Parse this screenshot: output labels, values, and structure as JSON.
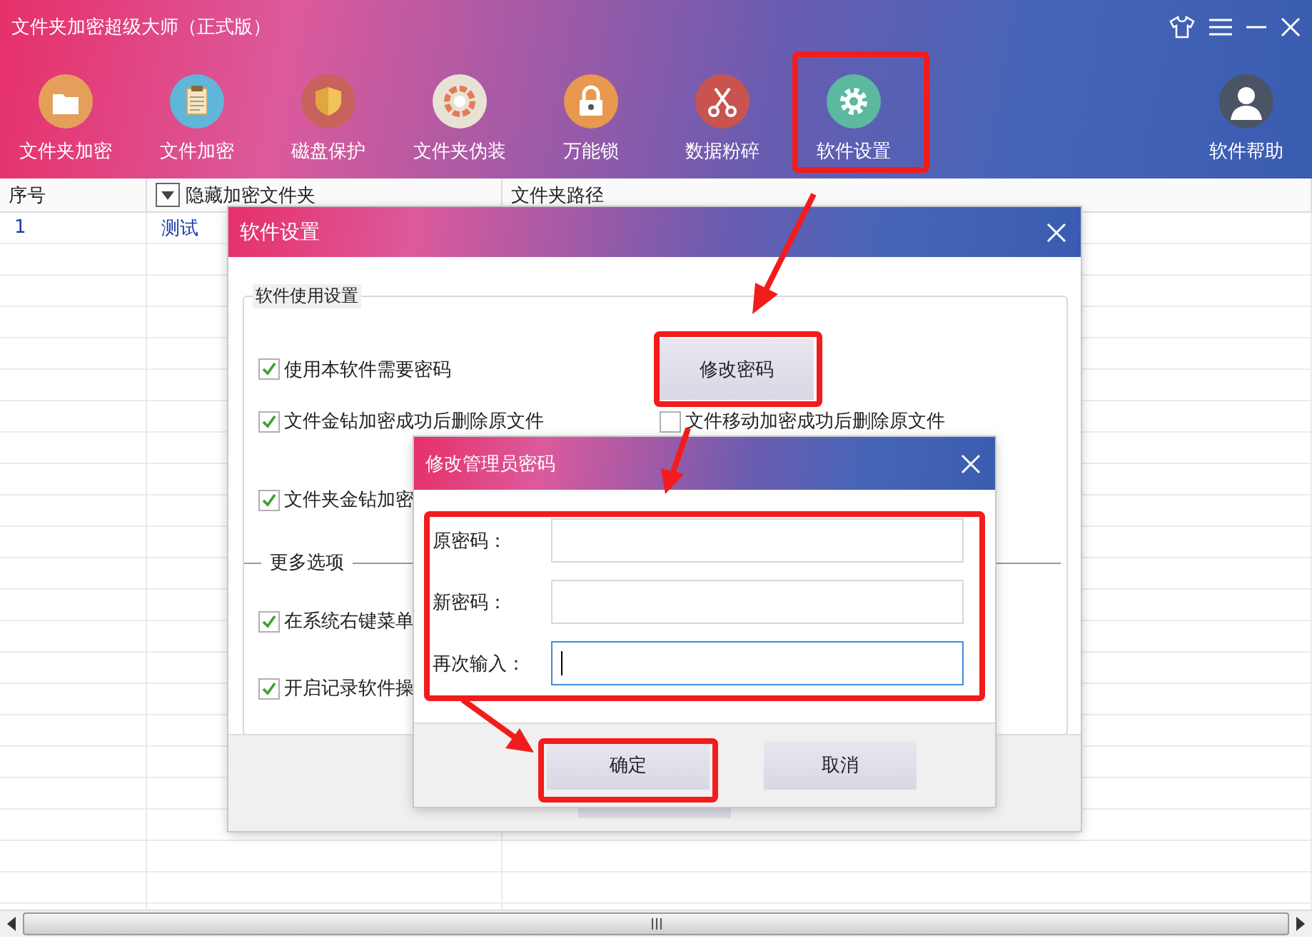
{
  "window": {
    "title": "文件夹加密超级大师（正式版）"
  },
  "toolbar": {
    "items": [
      {
        "label": "文件夹加密",
        "kind": "folder"
      },
      {
        "label": "文件加密",
        "kind": "file"
      },
      {
        "label": "磁盘保护",
        "kind": "shield"
      },
      {
        "label": "文件夹伪装",
        "kind": "palette"
      },
      {
        "label": "万能锁",
        "kind": "lock"
      },
      {
        "label": "数据粉碎",
        "kind": "scissors"
      },
      {
        "label": "软件设置",
        "kind": "gear"
      }
    ],
    "help": {
      "label": "软件帮助",
      "kind": "user"
    }
  },
  "table": {
    "columns": [
      "序号",
      "隐藏加密文件夹",
      "文件夹路径"
    ],
    "rows": [
      {
        "cells": [
          "1",
          "测试"
        ]
      }
    ]
  },
  "settings_dialog": {
    "title": "软件设置",
    "group_title": "软件使用设置",
    "change_password_button": "修改密码",
    "options": [
      {
        "label": "使用本软件需要密码",
        "checked": true
      },
      {
        "label": "文件金钻加密成功后删除原文件",
        "checked": true
      },
      {
        "label": "文件移动加密成功后删除原文件",
        "checked": false
      },
      {
        "label": "文件夹金钻加密",
        "checked": true
      }
    ],
    "more_options_title": "更多选项",
    "more_options": [
      {
        "label": "在系统右键菜单",
        "checked": true
      },
      {
        "label": "开启记录软件操",
        "checked": true
      }
    ]
  },
  "password_dialog": {
    "title": "修改管理员密码",
    "fields": [
      {
        "label": "原密码：",
        "focused": false
      },
      {
        "label": "新密码：",
        "focused": false
      },
      {
        "label": "再次输入：",
        "focused": true
      }
    ],
    "confirm_button": "确定",
    "cancel_button": "取消"
  }
}
